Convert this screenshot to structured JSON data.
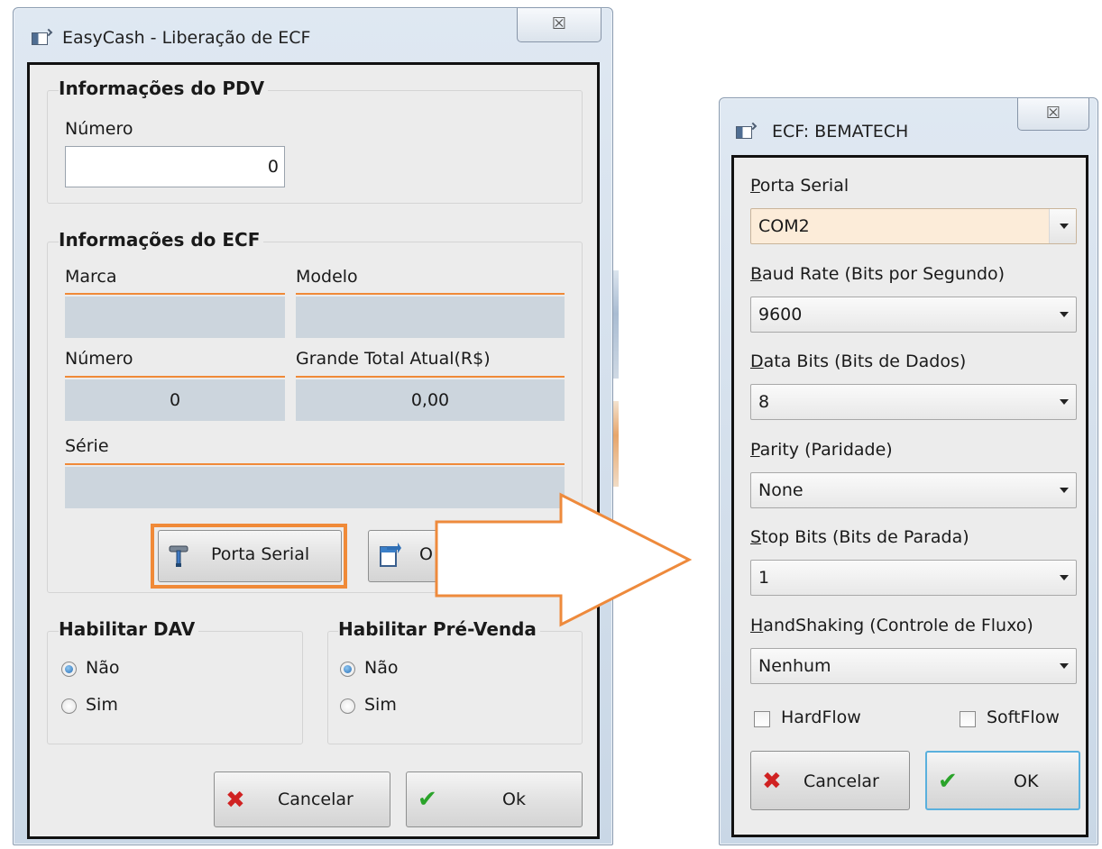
{
  "left_window": {
    "title": "EasyCash - Liberação de ECF",
    "close_glyph": "☒",
    "pdv_group": {
      "title": "Informações do PDV",
      "numero_label": "Número",
      "numero_value": "0"
    },
    "ecf_group": {
      "title": "Informações do ECF",
      "marca_label": "Marca",
      "marca_value": "",
      "modelo_label": "Modelo",
      "modelo_value": "",
      "numero_label": "Número",
      "numero_value": "0",
      "grande_total_label": "Grande Total Atual(R$)",
      "grande_total_value": "0,00",
      "serie_label": "Série",
      "serie_value": ""
    },
    "porta_serial_button": "Porta Serial",
    "second_button_visible": "O",
    "dav_group": {
      "title": "Habilitar DAV",
      "options": [
        "Não",
        "Sim"
      ],
      "selected": "Não"
    },
    "prevenda_group": {
      "title": "Habilitar Pré-Venda",
      "options": [
        "Não",
        "Sim"
      ],
      "selected": "Não"
    },
    "cancel_button": "Cancelar",
    "ok_button": "Ok"
  },
  "right_window": {
    "title": "ECF: BEMATECH",
    "close_glyph": "☒",
    "porta_serial": {
      "label_key": "P",
      "label_rest": "orta Serial",
      "value": "COM2"
    },
    "baud_rate": {
      "label_key": "B",
      "label_rest": "aud Rate (Bits por Segundo)",
      "value": "9600"
    },
    "data_bits": {
      "label_key": "D",
      "label_rest": "ata Bits (Bits de Dados)",
      "value": "8"
    },
    "parity": {
      "label_key": "P",
      "label_rest": "arity (Paridade)",
      "value": "None"
    },
    "stop_bits": {
      "label_key": "S",
      "label_rest": "top Bits (Bits de Parada)",
      "value": "1"
    },
    "handshaking": {
      "label_key": "H",
      "label_rest": "andShaking (Controle de Fluxo)",
      "value": "Nenhum"
    },
    "hardflow_label": "HardFlow",
    "softflow_label": "SoftFlow",
    "cancel_button": "Cancelar",
    "ok_button": "OK"
  },
  "colors": {
    "accent_orange": "#f08a38",
    "field_grey": "#ccd5dd",
    "cancel_red": "#d02222",
    "ok_green": "#2aa32a"
  }
}
